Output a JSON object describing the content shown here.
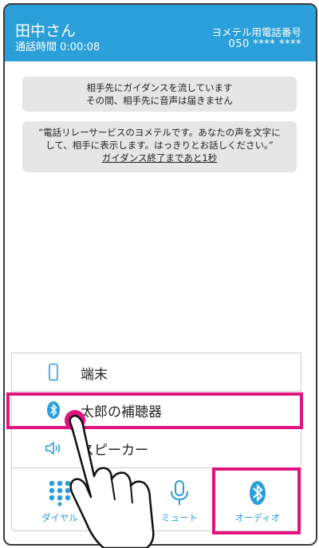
{
  "header": {
    "caller_name": "田中さん",
    "call_time": "通話時間 0:00:08",
    "number_label": "ヨメテル用電話番号",
    "number_value": "050 **** ****"
  },
  "messages": {
    "guidance_line1": "相手先にガイダンスを流しています",
    "guidance_line2": "その間、相手先に音声は届きません",
    "relay_line1": "“電話リレーサービスのヨメテルです。あなたの声を文字に",
    "relay_line2": "して、相手に表示します。はっきりとお話しください。”",
    "relay_line3": "ガイダンス終了まであと1秒"
  },
  "audio_options": [
    {
      "label": "端末",
      "icon": "phone-icon"
    },
    {
      "label": "太郎の補聴器",
      "icon": "bluetooth-icon"
    },
    {
      "label": "スピーカー",
      "icon": "speaker-icon"
    }
  ],
  "bottom_bar": {
    "dial_label": "ダイヤル",
    "mute_label": "ミュート",
    "audio_label": "オーディオ"
  },
  "colors": {
    "accent": "#2b9fd9",
    "highlight": "#e0147f",
    "message_bg": "#e6e6e6"
  }
}
